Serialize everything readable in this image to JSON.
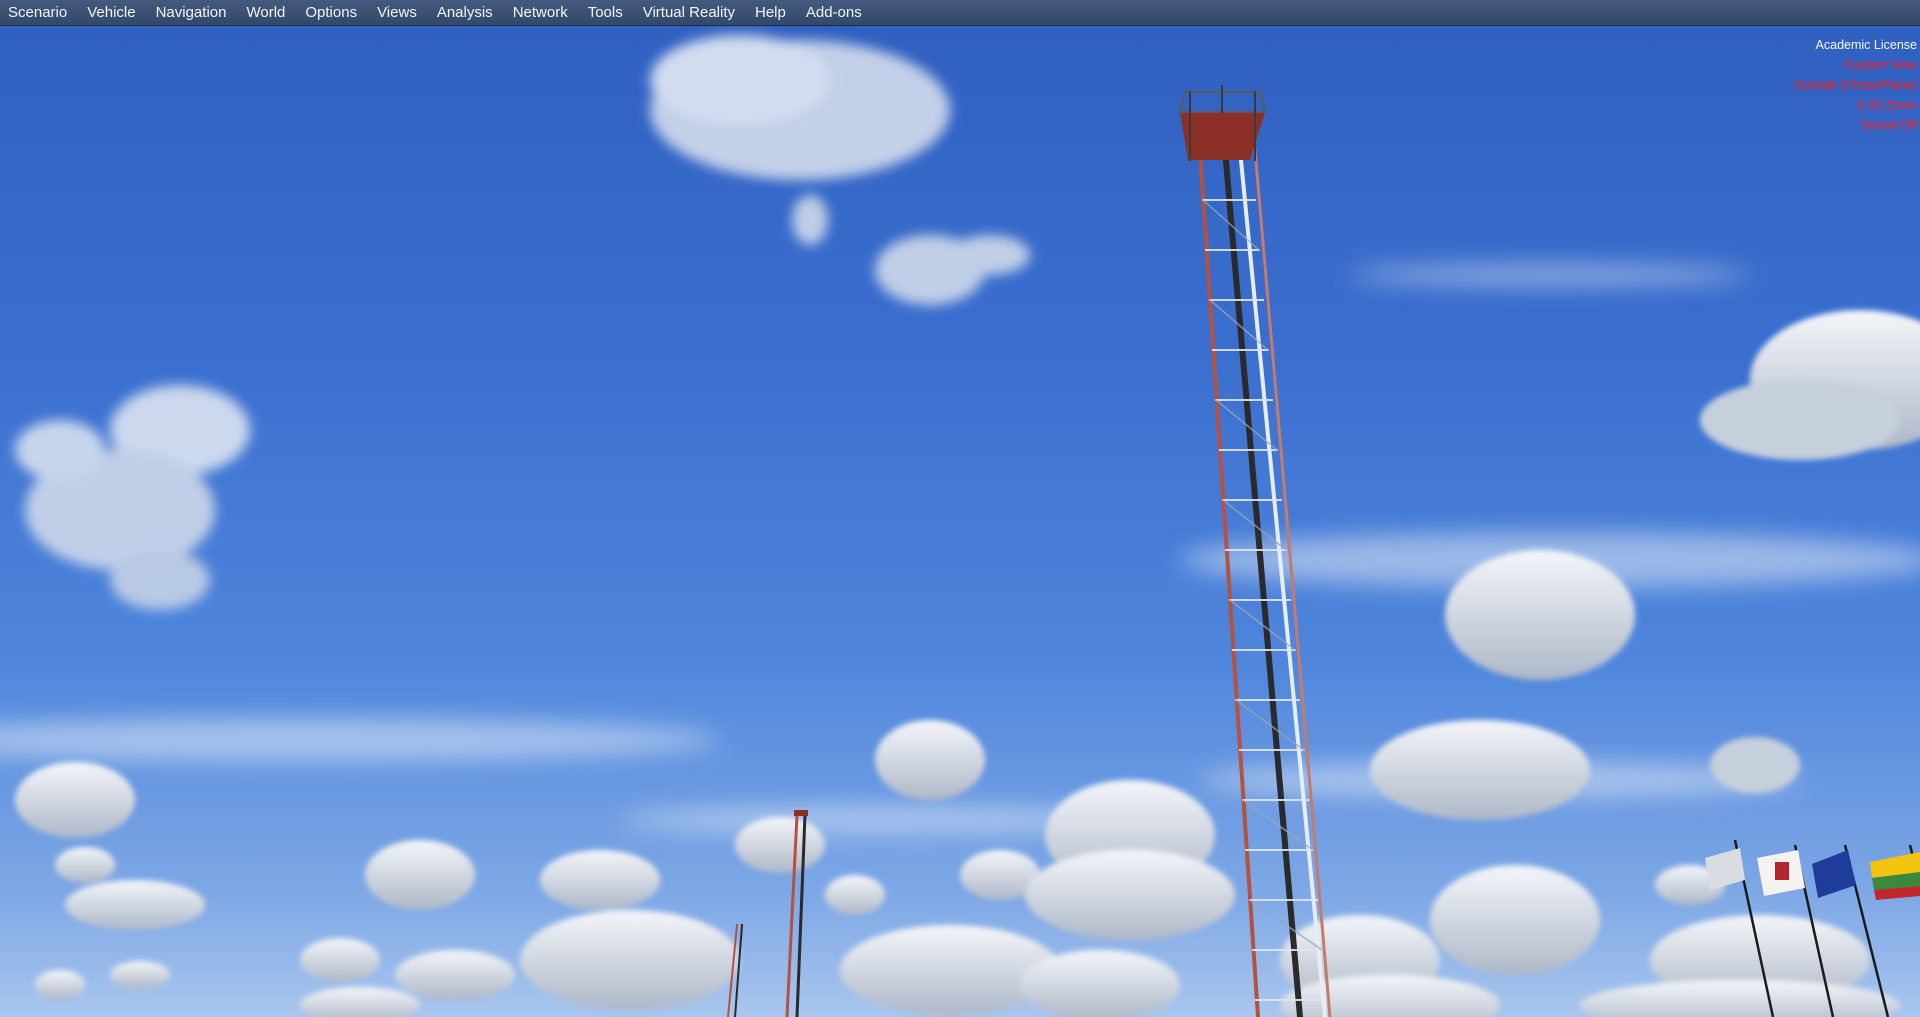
{
  "menubar": {
    "items": [
      {
        "label": "Scenario"
      },
      {
        "label": "Vehicle"
      },
      {
        "label": "Navigation"
      },
      {
        "label": "World"
      },
      {
        "label": "Options"
      },
      {
        "label": "Views"
      },
      {
        "label": "Analysis"
      },
      {
        "label": "Network"
      },
      {
        "label": "Tools"
      },
      {
        "label": "Virtual Reality"
      },
      {
        "label": "Help"
      },
      {
        "label": "Add-ons"
      }
    ]
  },
  "hud": {
    "license": "Academic License",
    "view_name": "Custom View",
    "camera_mode": "Outside (ChasePlane)",
    "zoom": "0.42 Zoom",
    "sound": "Sound Off"
  },
  "colors": {
    "sky_top": "#2f5fbf",
    "sky_horizon": "#a9c6ee",
    "hud_alert": "#ff1a1a",
    "tower_red": "#b5523e"
  }
}
